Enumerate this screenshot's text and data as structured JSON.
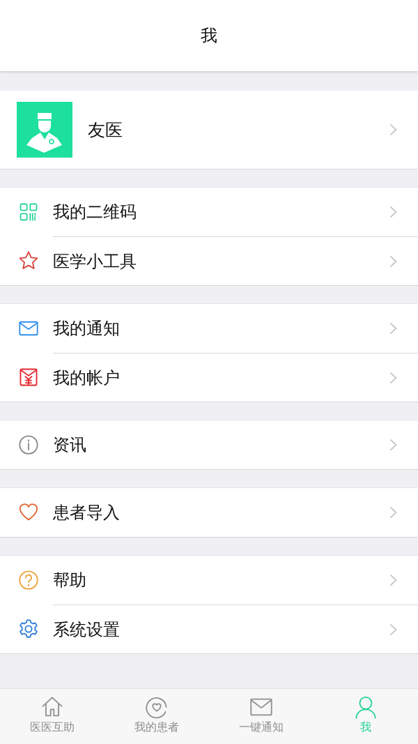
{
  "header": {
    "title": "我"
  },
  "profile": {
    "name": "友医"
  },
  "sections": [
    [
      {
        "label": "我的二维码"
      },
      {
        "label": "医学小工具"
      }
    ],
    [
      {
        "label": "我的通知"
      },
      {
        "label": "我的帐户"
      }
    ],
    [
      {
        "label": "资讯"
      }
    ],
    [
      {
        "label": "患者导入"
      }
    ],
    [
      {
        "label": "帮助"
      },
      {
        "label": "系统设置"
      }
    ]
  ],
  "tab_bar": [
    {
      "label": "医医互助",
      "selected": false
    },
    {
      "label": "我的患者",
      "selected": false
    },
    {
      "label": "一键通知",
      "selected": false
    },
    {
      "label": "我",
      "selected": true
    }
  ]
}
